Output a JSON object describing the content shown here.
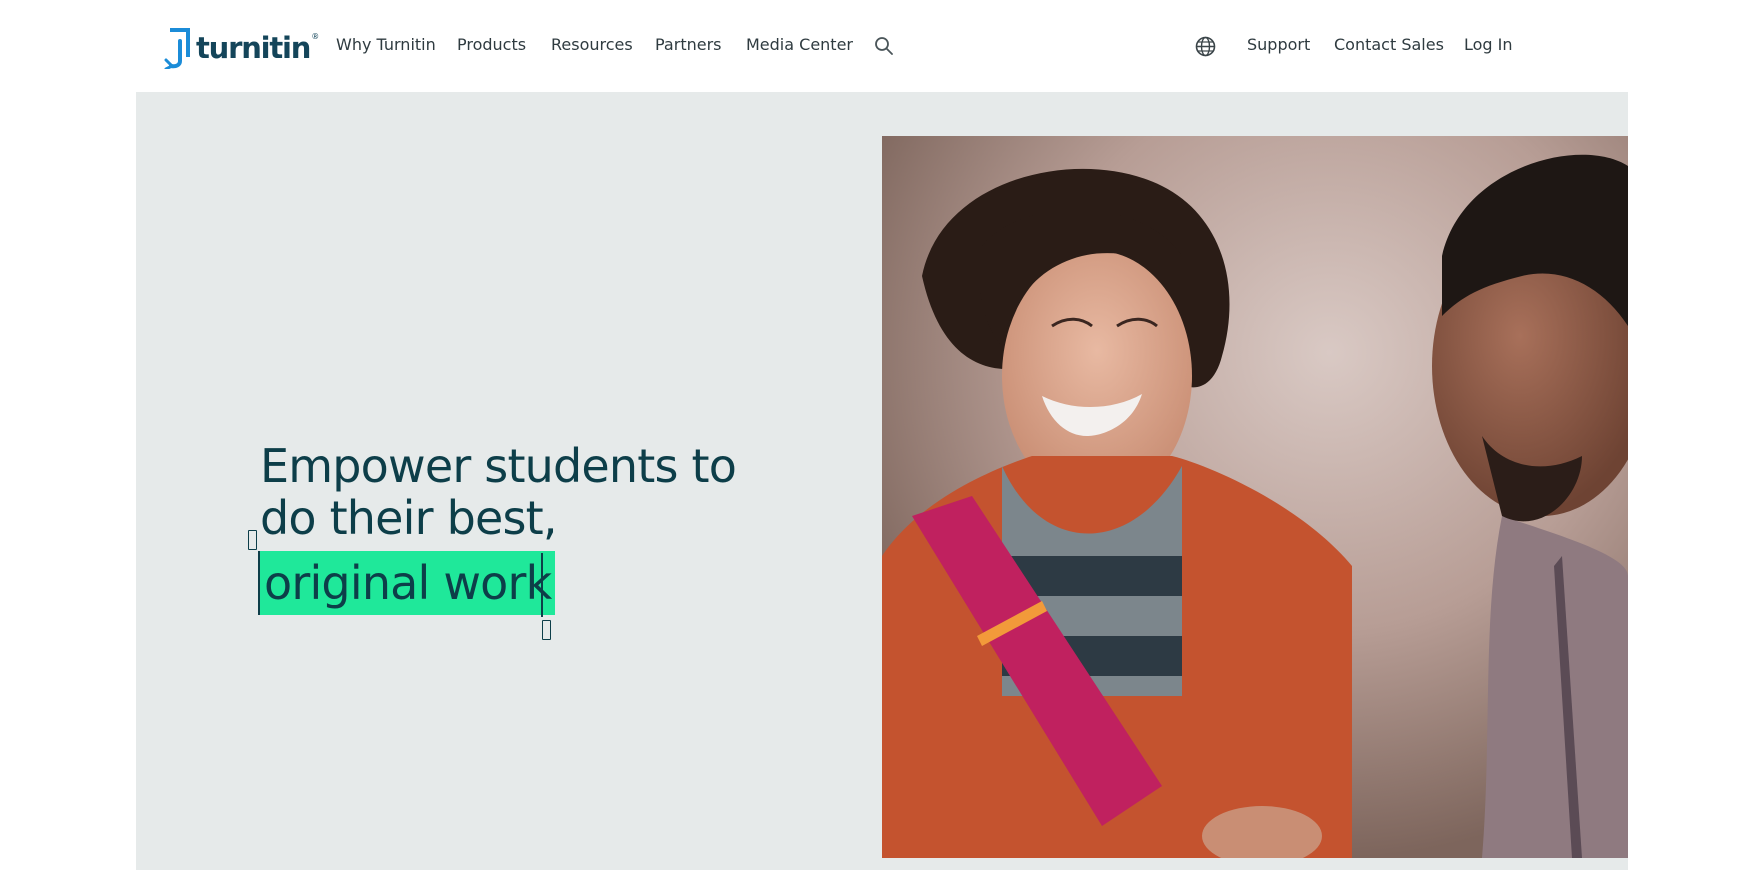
{
  "brand": {
    "logo_text": "turnitin",
    "logo_tm": "®"
  },
  "nav": {
    "left_items": [
      {
        "label": "Why Turnitin"
      },
      {
        "label": "Products"
      },
      {
        "label": "Resources"
      },
      {
        "label": "Partners"
      },
      {
        "label": "Media Center"
      }
    ],
    "right_items": [
      {
        "label": "Support"
      },
      {
        "label": "Contact Sales"
      },
      {
        "label": "Log In"
      }
    ],
    "icons": {
      "search": "search-icon",
      "language": "globe-icon"
    }
  },
  "hero": {
    "headline_line1": "Empower students to",
    "headline_line2": "do their best,",
    "headline_highlight": "original work",
    "highlight_color": "#1fe89a",
    "text_color": "#0d3e49",
    "background_color": "#e6eaea"
  },
  "photo": {
    "subject": "students-photo"
  }
}
